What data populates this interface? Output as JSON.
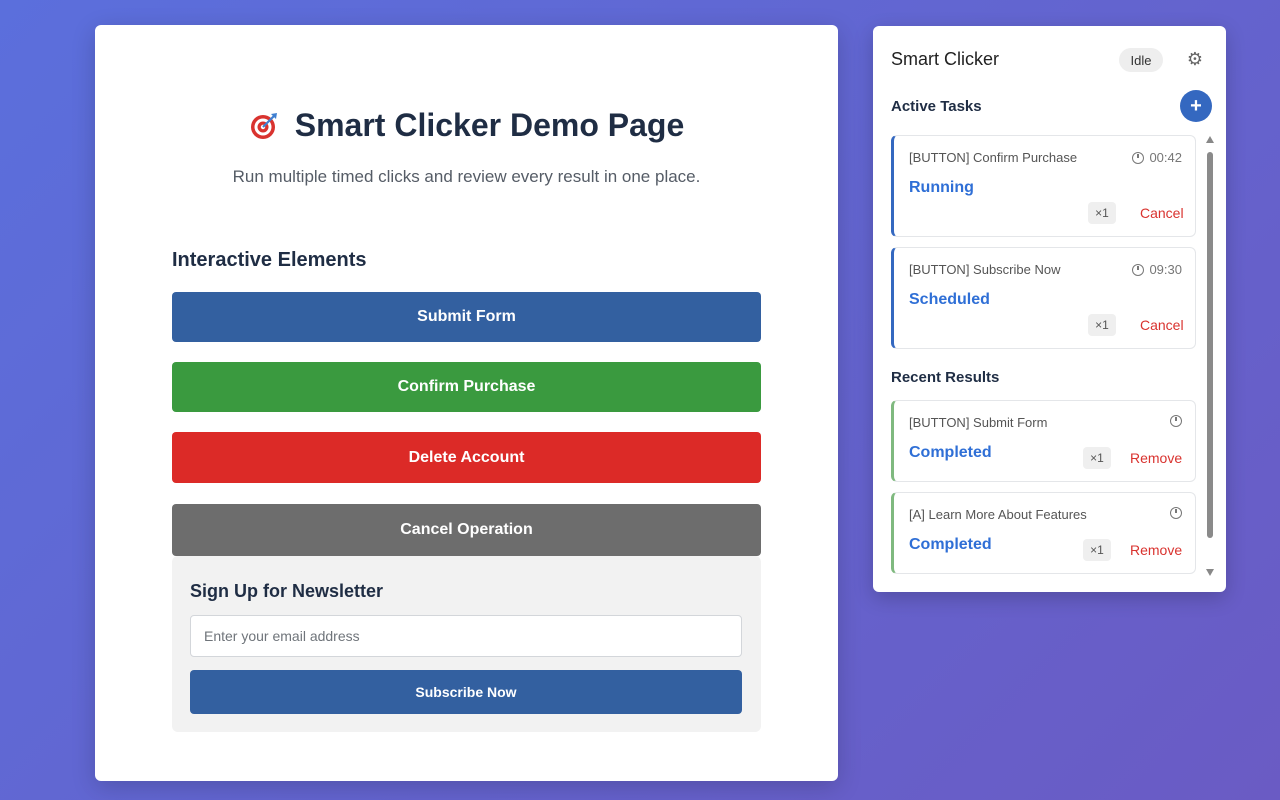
{
  "demo": {
    "title": "Smart Clicker Demo Page",
    "subtitle": "Run multiple timed clicks and review every result in one place.",
    "section_title": "Interactive Elements",
    "buttons": {
      "submit": "Submit Form",
      "confirm": "Confirm Purchase",
      "delete": "Delete Account",
      "cancel": "Cancel Operation"
    },
    "newsletter": {
      "title": "Sign Up for Newsletter",
      "email_placeholder": "Enter your email address",
      "subscribe_label": "Subscribe Now"
    }
  },
  "panel": {
    "title": "Smart Clicker",
    "status": "Idle",
    "add_label": "+",
    "active_label": "Active Tasks",
    "recent_label": "Recent Results",
    "active_tasks": [
      {
        "name": "[BUTTON] Confirm Purchase",
        "time": "00:42",
        "status": "Running",
        "count": "×1",
        "action": "Cancel"
      },
      {
        "name": "[BUTTON] Subscribe Now",
        "time": "09:30",
        "status": "Scheduled",
        "count": "×1",
        "action": "Cancel"
      }
    ],
    "recent_results": [
      {
        "name": "[BUTTON] Submit Form",
        "status": "Completed",
        "count": "×1",
        "action": "Remove"
      },
      {
        "name": "[A] Learn More About Features",
        "status": "Completed",
        "count": "×1",
        "action": "Remove"
      }
    ]
  },
  "colors": {
    "accent": "#3468c0",
    "success": "#3a9a3f",
    "danger": "#dc2a27",
    "neutral": "#6d6d6d"
  }
}
